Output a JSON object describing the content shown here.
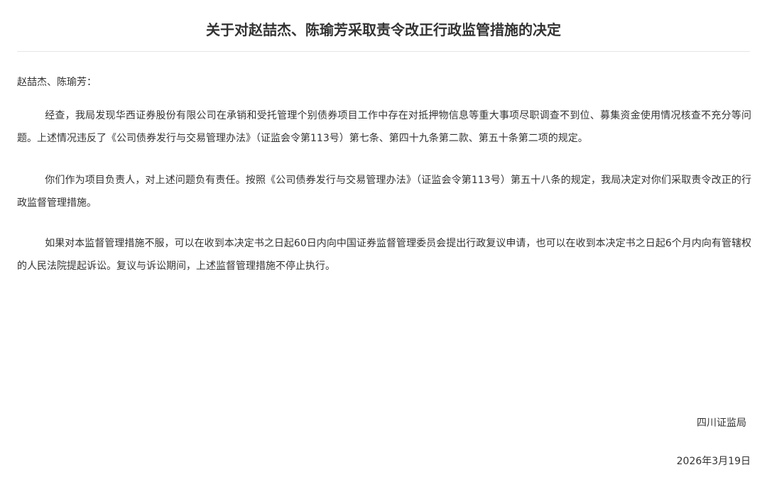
{
  "document": {
    "title": "关于对赵喆杰、陈瑜芳采取责令改正行政监管措施的决定",
    "salutation": "赵喆杰、陈瑜芳：",
    "paragraphs": [
      "经查，我局发现华西证券股份有限公司在承销和受托管理个别债券项目工作中存在对抵押物信息等重大事项尽职调查不到位、募集资金使用情况核查不充分等问题。上述情况违反了《公司债券发行与交易管理办法》（证监会令第113号）第七条、第四十九条第二款、第五十条第二项的规定。",
      "你们作为项目负责人，对上述问题负有责任。按照《公司债券发行与交易管理办法》（证监会令第113号）第五十八条的规定，我局决定对你们采取责令改正的行政监督管理措施。",
      "如果对本监督管理措施不服，可以在收到本决定书之日起60日内向中国证券监督管理委员会提出行政复议申请，也可以在收到本决定书之日起6个月内向有管辖权的人民法院提起诉讼。复议与诉讼期间，上述监督管理措施不停止执行。"
    ],
    "issuer": "四川证监局",
    "date": "2026年3月19日"
  }
}
